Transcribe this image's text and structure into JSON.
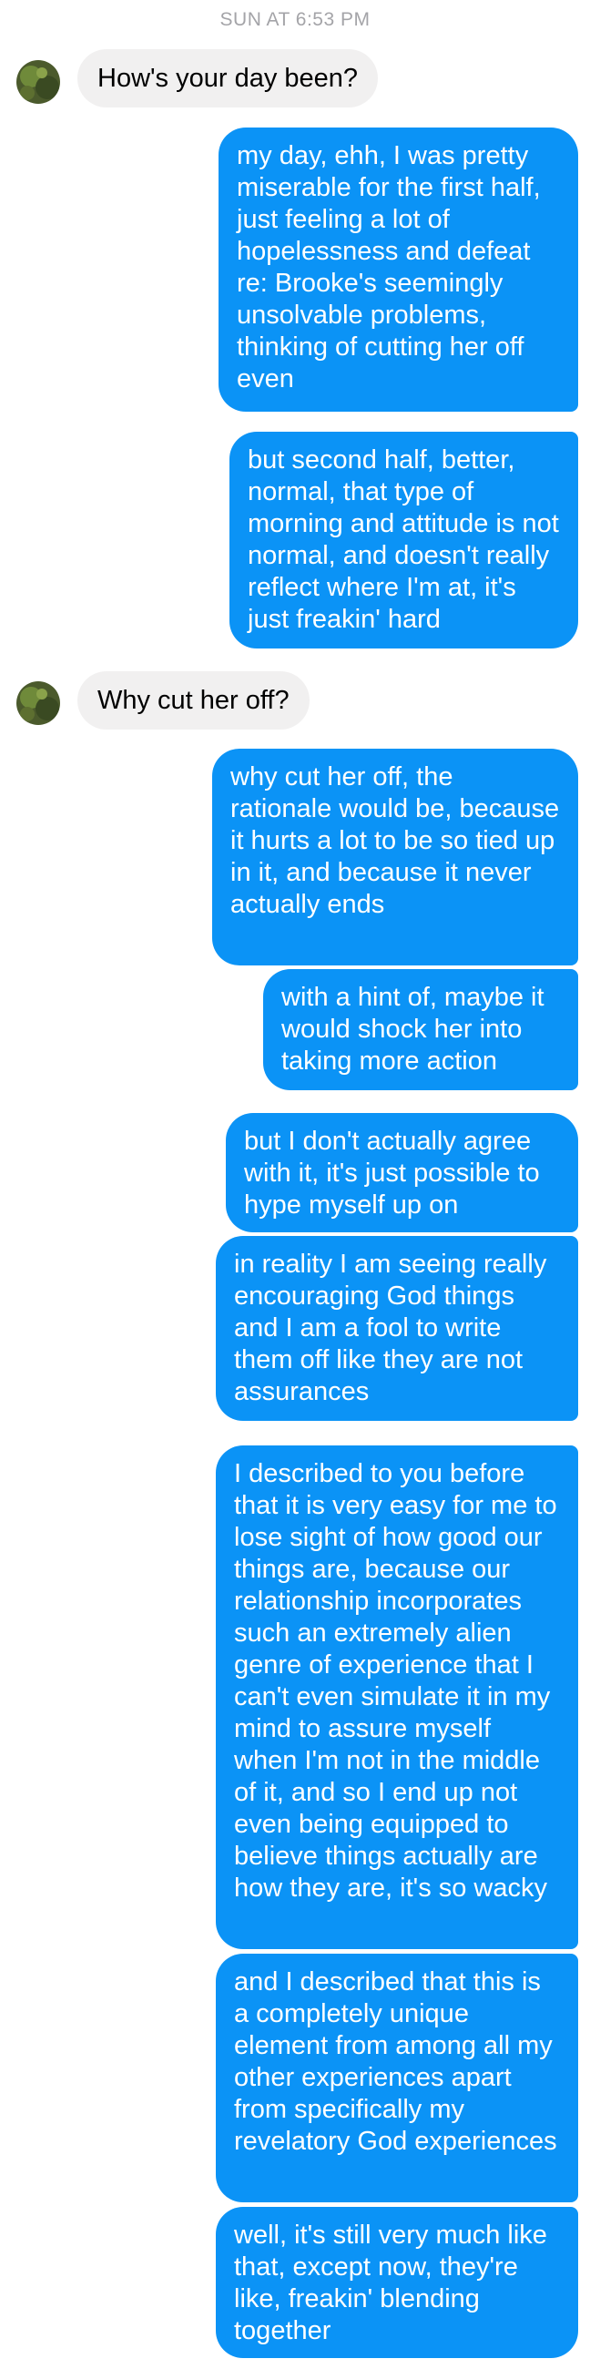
{
  "conversation": {
    "timestamp": "SUN AT 6:53 PM",
    "contact_avatar_icon": "contact-avatar-photo",
    "colors": {
      "outgoing_bubble": "#0b93f6",
      "incoming_bubble": "#f1f0f0",
      "timestamp_text": "#a4a4a8"
    },
    "messages": [
      {
        "from": "contact",
        "text": "How's your day been?"
      },
      {
        "from": "me",
        "text": "my day, ehh, I was pretty miserable for the first half, just feeling a lot of hopelessness and defeat re: Brooke's seemingly unsolvable problems, thinking of cutting her off even"
      },
      {
        "from": "me",
        "text": "but second half, better, normal, that type of morning and attitude is not normal, and doesn't really reflect where I'm at, it's just freakin' hard"
      },
      {
        "from": "contact",
        "text": "Why cut her off?"
      },
      {
        "from": "me",
        "text": "why cut her off, the rationale would be, because it hurts a lot to be so tied up in it, and because it never actually ends"
      },
      {
        "from": "me",
        "text": "with a hint of, maybe it would shock her into taking more action"
      },
      {
        "from": "me",
        "text": "but I don't actually agree with it, it's just possible to hype myself up on"
      },
      {
        "from": "me",
        "text": "in reality I am seeing really encouraging God things and I am a fool to write them off like they are not assurances"
      },
      {
        "from": "me",
        "text": "I described to you before that it is very easy for me to lose sight of how good our things are, because our relationship incorporates such an extremely alien genre of experience that I can't even simulate it in my mind to assure myself when I'm not in the middle of it, and so I end up not even being equipped to believe things actually are how they are, it's so wacky"
      },
      {
        "from": "me",
        "text": "and I described that this is a completely unique element from among all my other experiences apart from specifically my revelatory God experiences"
      },
      {
        "from": "me",
        "text": "well, it's still very much like that, except now, they're like, freakin' blending together"
      }
    ]
  }
}
